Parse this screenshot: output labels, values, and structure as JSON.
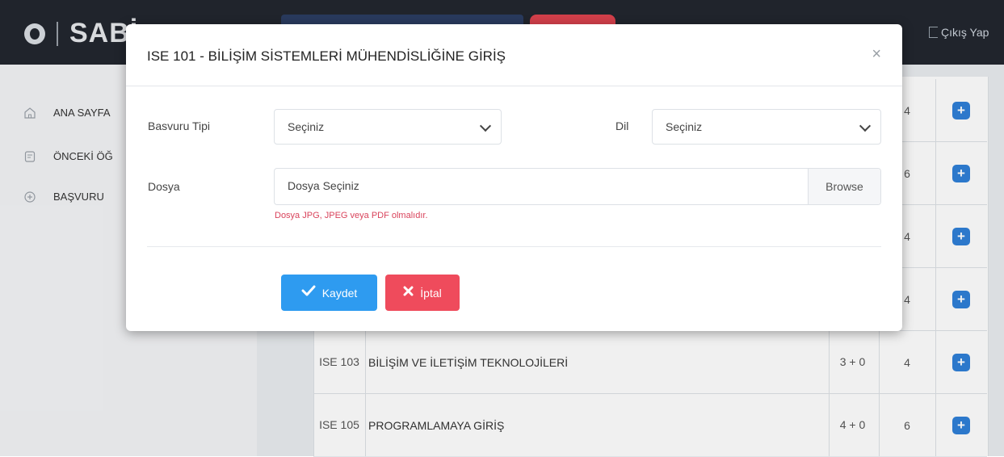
{
  "header": {
    "logo_text": "SABİ",
    "logout_label": "Çıkış Yap"
  },
  "sidebar": {
    "items": [
      {
        "label": "ANA SAYFA",
        "icon": "home-icon"
      },
      {
        "label": "ÖNCEKİ ÖĞ",
        "icon": "document-icon"
      },
      {
        "label": "BAŞVURU",
        "icon": "plus-circle-icon"
      }
    ]
  },
  "table": {
    "rows": [
      {
        "code": "",
        "name": "",
        "hours": "",
        "credit": "4"
      },
      {
        "code": "",
        "name": "",
        "hours": "",
        "credit": "6"
      },
      {
        "code": "",
        "name": "",
        "hours": "",
        "credit": "4"
      },
      {
        "code": "",
        "name": "",
        "hours": "",
        "credit": "4"
      },
      {
        "code": "ISE 103",
        "name": "BİLİŞİM VE İLETİŞİM TEKNOLOJİLERİ",
        "hours": "3 + 0",
        "credit": "4"
      },
      {
        "code": "ISE 105",
        "name": "PROGRAMLAMAYA GİRİŞ",
        "hours": "4 + 0",
        "credit": "6"
      }
    ],
    "add_button_label": "+"
  },
  "modal": {
    "title": "ISE 101 - BİLİŞİM SİSTEMLERİ MÜHENDİSLİĞİNE GİRİŞ",
    "close_label": "×",
    "application_type": {
      "label": "Basvuru Tipi",
      "value": "Seçiniz"
    },
    "language": {
      "label": "Dil",
      "value": "Seçiniz"
    },
    "file": {
      "label": "Dosya",
      "value": "Dosya Seçiniz",
      "browse_label": "Browse",
      "hint": "Dosya JPG, JPEG veya PDF olmalıdır."
    },
    "save_label": "Kaydet",
    "cancel_label": "İptal"
  },
  "colors": {
    "header_bg": "#23272f",
    "primary_blue": "#2e9bf0",
    "danger_red": "#ef4b5c",
    "hint_red": "#d9435b"
  }
}
